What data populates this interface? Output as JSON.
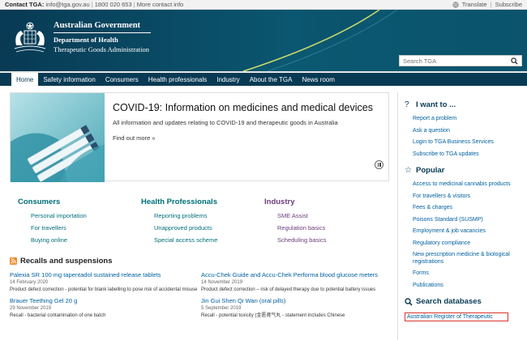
{
  "topbar": {
    "contact_label": "Contact TGA:",
    "email": "info@tga.gov.au",
    "phone": "1800 020 653",
    "more_contact": "More contact info",
    "translate": "Translate",
    "subscribe": "Subscribe"
  },
  "header": {
    "gov": "Australian Government",
    "dept": "Department of Health",
    "tga": "Therapeutic Goods Administration",
    "search_placeholder": "Search TGA"
  },
  "nav": {
    "items": [
      "Home",
      "Safety information",
      "Consumers",
      "Health professionals",
      "Industry",
      "About the TGA",
      "News room"
    ]
  },
  "feature": {
    "title": "COVID-19: Information on medicines and medical devices",
    "desc": "All information and updates relating to COVID-19 and therapeutic goods in Australia",
    "more": "Find out more »"
  },
  "audience": {
    "consumers": {
      "title": "Consumers",
      "links": [
        "Personal importation",
        "For travellers",
        "Buying online"
      ]
    },
    "health": {
      "title": "Health Professionals",
      "links": [
        "Reporting problems",
        "Unapproved products",
        "Special access scheme"
      ]
    },
    "industry": {
      "title": "Industry",
      "links": [
        "SME Assist",
        "Regulation basics",
        "Scheduling basics"
      ]
    }
  },
  "recalls": {
    "title": "Recalls and suspensions",
    "items": [
      {
        "title": "Palexia SR 100 mg tapentadol sustained release tablets",
        "date": "14 February 2020",
        "desc": "Product defect correction - potential for blank labelling to pose risk of accidental misuse"
      },
      {
        "title": "Accu-Chek Guide and Accu-Chek Performa blood glucose meters",
        "date": "14 November 2019",
        "desc": "Product defect correction – risk of delayed therapy due to potential battery issues"
      },
      {
        "title": "Brauer Teething Gel 20 g",
        "date": "29 November 2019",
        "desc": "Recall - bacterial contamination of one batch"
      },
      {
        "title": "Jin Gui Shen Qi Wan (oral pills)",
        "date": "5 September 2019",
        "desc": "Recall - potential toxicity (金匮肾气丸 - statement includes Chinese"
      }
    ]
  },
  "sidebar": {
    "want_title": "I want to ...",
    "want_links": [
      "Report a problem",
      "Ask a question",
      "Login to TGA Business Services",
      "Subscribe to TGA updates"
    ],
    "popular_title": "Popular",
    "popular_links": [
      "Access to medicinal cannabis products",
      "For travellers & visitors",
      "Fees & charges",
      "Poisons Standard (SUSMP)",
      "Employment & job vacancies",
      "Regulatory compliance",
      "New prescription medicine & biological registrations",
      "Forms",
      "Publications"
    ],
    "search_db_title": "Search databases",
    "db_link": "Australian Register of Therapeutic"
  }
}
